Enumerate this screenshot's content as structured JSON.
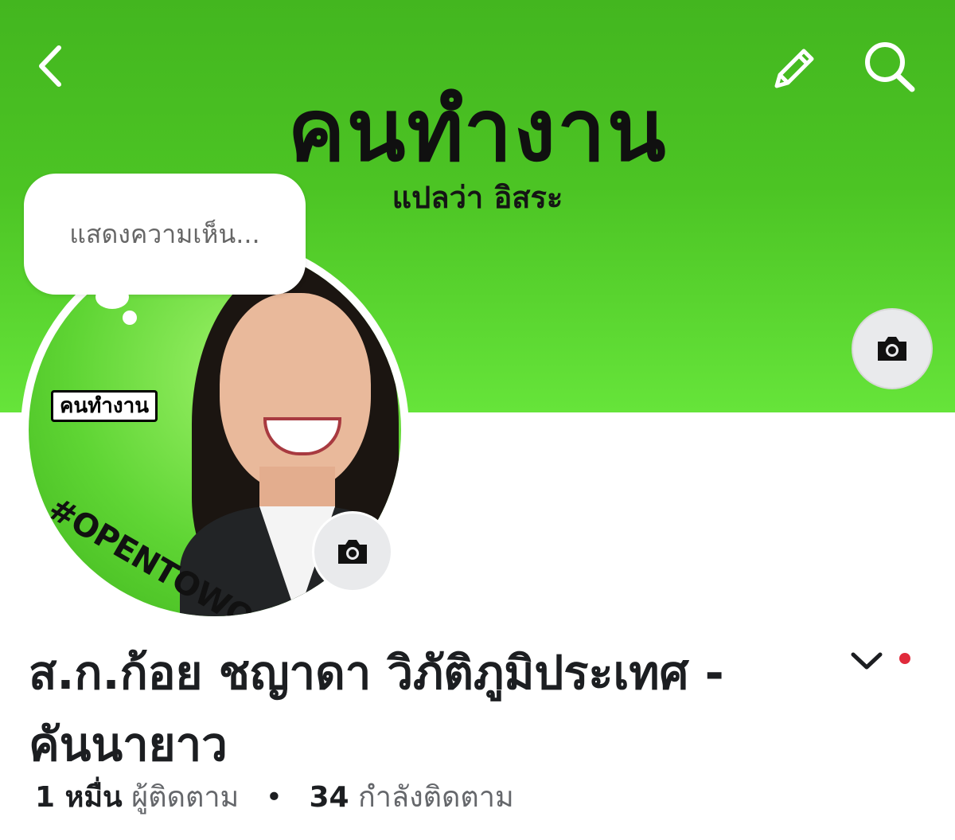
{
  "header": {
    "back_icon": "chevron-left-icon",
    "edit_icon": "pencil-icon",
    "search_icon": "search-icon"
  },
  "cover": {
    "title": "คนทำงาน",
    "subtitle": "แปลว่า อิสระ",
    "camera_icon": "camera-icon",
    "gradient_colors": [
      "#43b61f",
      "#66e43a"
    ]
  },
  "note_bubble": {
    "placeholder": "แสดงความเห็น..."
  },
  "avatar": {
    "badge_text": "คนทำงาน",
    "hashtag": "#OPENTOWORK",
    "camera_icon": "camera-icon"
  },
  "profile": {
    "name": "ส.ก.ก้อย ชญาดา วิภัติภูมิประเทศ - คันนายาว",
    "dropdown_icon": "chevron-down-icon",
    "notification_dot_color": "#e02a3b",
    "followers_count": "1 หมื่น",
    "followers_label": "ผู้ติดตาม",
    "separator": "•",
    "following_count": "34",
    "following_label": "กำลังติดตาม"
  }
}
